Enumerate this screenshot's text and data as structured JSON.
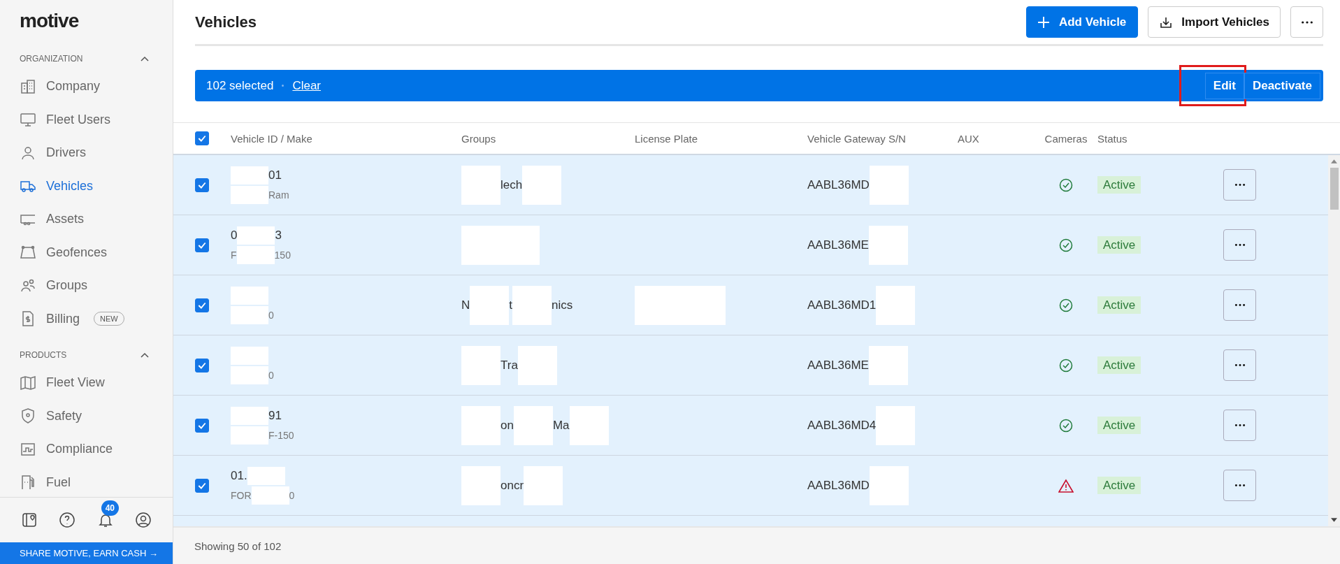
{
  "sidebar": {
    "logo": "motive",
    "sections": [
      {
        "title": "ORGANIZATION",
        "expanded": true,
        "items": [
          {
            "label": "Company",
            "selected": false
          },
          {
            "label": "Fleet Users",
            "selected": false
          },
          {
            "label": "Drivers",
            "selected": false
          },
          {
            "label": "Vehicles",
            "selected": true
          },
          {
            "label": "Assets",
            "selected": false
          },
          {
            "label": "Geofences",
            "selected": false
          },
          {
            "label": "Groups",
            "selected": false
          },
          {
            "label": "Billing",
            "selected": false,
            "badge": "NEW"
          }
        ]
      },
      {
        "title": "PRODUCTS",
        "expanded": true,
        "items": [
          {
            "label": "Fleet View",
            "selected": false
          },
          {
            "label": "Safety",
            "selected": false
          },
          {
            "label": "Compliance",
            "selected": false
          },
          {
            "label": "Fuel",
            "selected": false
          }
        ]
      }
    ],
    "notification_count": "40",
    "promo": "SHARE MOTIVE, EARN CASH →"
  },
  "header": {
    "title": "Vehicles",
    "primary_button": "Add Vehicle",
    "secondary_button": "Import Vehicles"
  },
  "selection_bar": {
    "count_text": "102 selected",
    "clear_link": "Clear",
    "actions": [
      {
        "label": "Edit",
        "highlighted": true
      },
      {
        "label": "Deactivate",
        "highlighted": false
      }
    ]
  },
  "table": {
    "all_checked": true,
    "columns": [
      "Vehicle ID / Make",
      "Groups",
      "License Plate",
      "Vehicle Gateway S/N",
      "AUX",
      "Cameras",
      "Status"
    ],
    "rows": [
      {
        "checked": true,
        "id": [
          {
            "kind": "redaction"
          },
          {
            "kind": "text",
            "text": "01"
          }
        ],
        "make": [
          {
            "kind": "redaction"
          },
          {
            "kind": "text",
            "text": "Ram"
          }
        ],
        "groups": [
          {
            "kind": "redaction"
          },
          {
            "kind": "text",
            "text": "lech"
          },
          {
            "kind": "redaction"
          }
        ],
        "plate": [],
        "gateway": [
          {
            "kind": "text",
            "text": "AABL36MD"
          },
          {
            "kind": "redaction"
          }
        ],
        "camera_warning": false,
        "status": "Active"
      },
      {
        "checked": true,
        "id": [
          {
            "kind": "text",
            "text": "0"
          },
          {
            "kind": "redaction"
          },
          {
            "kind": "text",
            "text": "3"
          }
        ],
        "make": [
          {
            "kind": "text",
            "text": "F"
          },
          {
            "kind": "redaction"
          },
          {
            "kind": "text",
            "text": "150"
          }
        ],
        "groups": [
          {
            "kind": "redaction"
          },
          {
            "kind": "redaction"
          }
        ],
        "plate": [],
        "gateway": [
          {
            "kind": "text",
            "text": "AABL36ME"
          },
          {
            "kind": "redaction"
          }
        ],
        "camera_warning": false,
        "status": "Active"
      },
      {
        "checked": true,
        "id": [
          {
            "kind": "redaction"
          }
        ],
        "make": [
          {
            "kind": "redaction"
          },
          {
            "kind": "text",
            "text": "0"
          }
        ],
        "groups": [
          {
            "kind": "text",
            "text": "N"
          },
          {
            "kind": "redaction"
          },
          {
            "kind": "text",
            "text": "t"
          },
          {
            "kind": "redaction"
          },
          {
            "kind": "text",
            "text": "nics"
          }
        ],
        "plate": [
          {
            "kind": "redaction"
          }
        ],
        "gateway": [
          {
            "kind": "text",
            "text": "AABL36MD1"
          },
          {
            "kind": "redaction"
          }
        ],
        "camera_warning": false,
        "status": "Active"
      },
      {
        "checked": true,
        "id": [
          {
            "kind": "redaction"
          }
        ],
        "make": [
          {
            "kind": "redaction"
          },
          {
            "kind": "text",
            "text": "0"
          }
        ],
        "groups": [
          {
            "kind": "redaction"
          },
          {
            "kind": "text",
            "text": "Tra"
          },
          {
            "kind": "redaction"
          }
        ],
        "plate": [],
        "gateway": [
          {
            "kind": "text",
            "text": "AABL36ME"
          },
          {
            "kind": "redaction"
          }
        ],
        "camera_warning": false,
        "status": "Active"
      },
      {
        "checked": true,
        "id": [
          {
            "kind": "redaction"
          },
          {
            "kind": "text",
            "text": "91"
          }
        ],
        "make": [
          {
            "kind": "redaction"
          },
          {
            "kind": "text",
            "text": "F-150"
          }
        ],
        "groups": [
          {
            "kind": "redaction"
          },
          {
            "kind": "text",
            "text": "on"
          },
          {
            "kind": "redaction"
          },
          {
            "kind": "text",
            "text": "Ma"
          },
          {
            "kind": "redaction"
          }
        ],
        "plate": [],
        "gateway": [
          {
            "kind": "text",
            "text": "AABL36MD4"
          },
          {
            "kind": "redaction"
          }
        ],
        "camera_warning": false,
        "status": "Active"
      },
      {
        "checked": true,
        "id": [
          {
            "kind": "text",
            "text": "01."
          },
          {
            "kind": "redaction"
          }
        ],
        "make": [
          {
            "kind": "text",
            "text": "FOR"
          },
          {
            "kind": "redaction"
          },
          {
            "kind": "text",
            "text": "0"
          }
        ],
        "groups": [
          {
            "kind": "redaction"
          },
          {
            "kind": "text",
            "text": "oncr"
          },
          {
            "kind": "redaction"
          }
        ],
        "plate": [],
        "gateway": [
          {
            "kind": "text",
            "text": "AABL36MD"
          },
          {
            "kind": "redaction"
          }
        ],
        "camera_warning": true,
        "status": "Active"
      }
    ]
  },
  "footer": {
    "summary": "Showing 50 of 102"
  }
}
